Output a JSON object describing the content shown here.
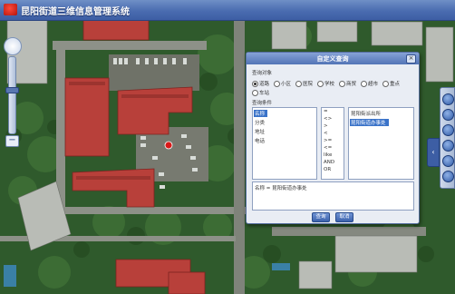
{
  "app": {
    "title": "昆阳街道三维信息管理系统"
  },
  "dialog": {
    "title": "自定义查询",
    "close_symbol": "×",
    "target_label": "查询对象",
    "targets": [
      {
        "label": "道路",
        "selected": true
      },
      {
        "label": "小区",
        "selected": false
      },
      {
        "label": "医院",
        "selected": false
      },
      {
        "label": "学校",
        "selected": false
      },
      {
        "label": "商贸",
        "selected": false
      },
      {
        "label": "超市",
        "selected": false
      },
      {
        "label": "重点",
        "selected": false
      },
      {
        "label": "车站",
        "selected": false
      }
    ],
    "condition_label": "查询条件",
    "fields": [
      {
        "label": "名称",
        "selected": true
      },
      {
        "label": "分类",
        "selected": false
      },
      {
        "label": "地址",
        "selected": false
      },
      {
        "label": "电话",
        "selected": false
      }
    ],
    "operators": [
      "=",
      "<>",
      ">",
      "<",
      ">=",
      "<=",
      "like",
      "AND",
      "OR"
    ],
    "values": [
      {
        "label": "昆阳街派出所",
        "selected": false
      },
      {
        "label": "昆阳街道办事处",
        "selected": true
      }
    ],
    "expression": "名称 = 昆阳街道办事处",
    "ok_label": "查询",
    "cancel_label": "取消"
  },
  "map": {
    "zoom_in_symbol": "+",
    "zoom_out_symbol": "−",
    "right_tab_symbol": "‹",
    "right_tools": [
      "zoom-in-icon",
      "zoom-out-icon",
      "pan-icon",
      "measure-icon",
      "info-icon",
      "layers-icon"
    ]
  },
  "colors": {
    "title_bar": "#4a6cb0",
    "dialog_header": "#5274b6",
    "selection": "#3a73c9",
    "roof_red": "#b8403a",
    "vegetation": "#2f5a2c"
  }
}
